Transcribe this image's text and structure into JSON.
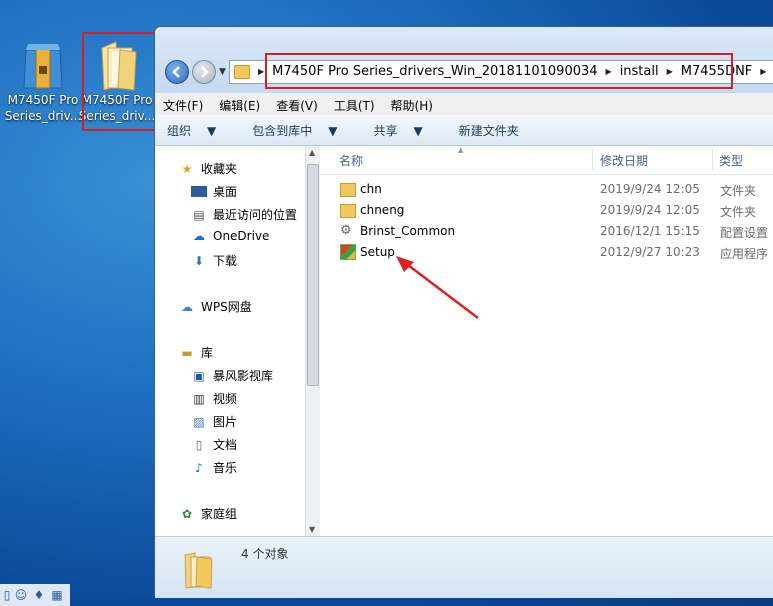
{
  "desktop": {
    "icon1": {
      "line1": "M7450F Pro",
      "line2": "Series_driv..."
    },
    "icon2": {
      "line1": "M7450F Pro",
      "line2": "Series_driv..."
    }
  },
  "address": {
    "crumbs": [
      "M7450F Pro Series_drivers_Win_20181101090034",
      "install",
      "M7455DNF"
    ]
  },
  "menu": [
    "文件(F)",
    "编辑(E)",
    "查看(V)",
    "工具(T)",
    "帮助(H)"
  ],
  "toolbar": {
    "organize": "组织",
    "include": "包含到库中",
    "share": "共享",
    "newfolder": "新建文件夹"
  },
  "nav": {
    "favorites": "收藏夹",
    "desktop": "桌面",
    "recent": "最近访问的位置",
    "onedrive": "OneDrive",
    "downloads": "下载",
    "wps": "WPS网盘",
    "library": "库",
    "baofeng": "暴风影视库",
    "videos": "视频",
    "pictures": "图片",
    "documents": "文档",
    "music": "音乐",
    "homegroup": "家庭组"
  },
  "columns": {
    "name": "名称",
    "date": "修改日期",
    "type": "类型"
  },
  "files": [
    {
      "name": "chn",
      "date": "2019/9/24 12:05",
      "type": "文件夹",
      "icon": "folder-icon"
    },
    {
      "name": "chneng",
      "date": "2019/9/24 12:05",
      "type": "文件夹",
      "icon": "folder-icon"
    },
    {
      "name": "Brinst_Common",
      "date": "2016/12/1 15:15",
      "type": "配置设置",
      "icon": "settings-file-icon"
    },
    {
      "name": "Setup",
      "date": "2012/9/27 10:23",
      "type": "应用程序",
      "icon": "setup-exe-icon"
    }
  ],
  "status": {
    "count": "4 个对象"
  },
  "colors": {
    "highlight": "#d62020",
    "accent": "#2d6cc0"
  }
}
